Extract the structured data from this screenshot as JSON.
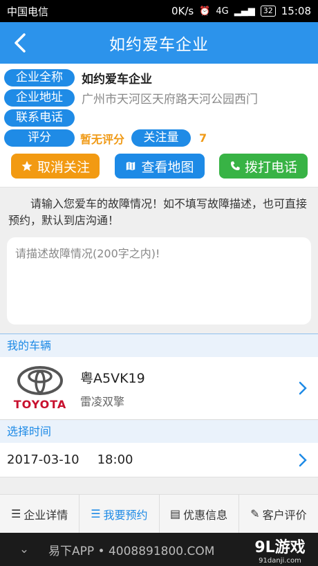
{
  "status": {
    "carrier": "中国电信",
    "speed": "0K/s",
    "network": "4G",
    "battery": "32",
    "time": "15:08"
  },
  "header": {
    "title": "如约爱车企业"
  },
  "info": {
    "name_label": "企业全称",
    "name": "如约爱车企业",
    "address_label": "企业地址",
    "address": "广州市天河区天府路天河公园西门",
    "phone_label": "联系电话",
    "rating_label": "评分",
    "rating": "暂无评分",
    "follow_label": "关注量",
    "follow_count": "7"
  },
  "actions": {
    "unfollow": "取消关注",
    "map": "查看地图",
    "call": "拨打电话"
  },
  "notice": "请输入您爱车的故障情况！如不填写故障描述，也可直接预约，默认到店沟通！",
  "description": {
    "placeholder": "请描述故障情况(200字之内)!"
  },
  "vehicle": {
    "section": "我的车辆",
    "brand": "TOYOTA",
    "plate": "粤A5VK19",
    "model": "雷凌双擎"
  },
  "schedule": {
    "section": "选择时间",
    "date": "2017-03-10",
    "time": "18:00"
  },
  "tabs": [
    {
      "label": "企业详情",
      "icon": "list-icon"
    },
    {
      "label": "我要预约",
      "icon": "list-icon"
    },
    {
      "label": "优惠信息",
      "icon": "folder-icon"
    },
    {
      "label": "客户评价",
      "icon": "edit-icon"
    }
  ],
  "bottombar": {
    "ad": "易下APP • 4008891800.COM",
    "watermark": "9L游戏",
    "watermark_url": "91danji.com"
  },
  "colors": {
    "primary": "#2c93eb",
    "orange": "#f29a12",
    "green": "#38b345",
    "toyota_red": "#c8102e"
  }
}
